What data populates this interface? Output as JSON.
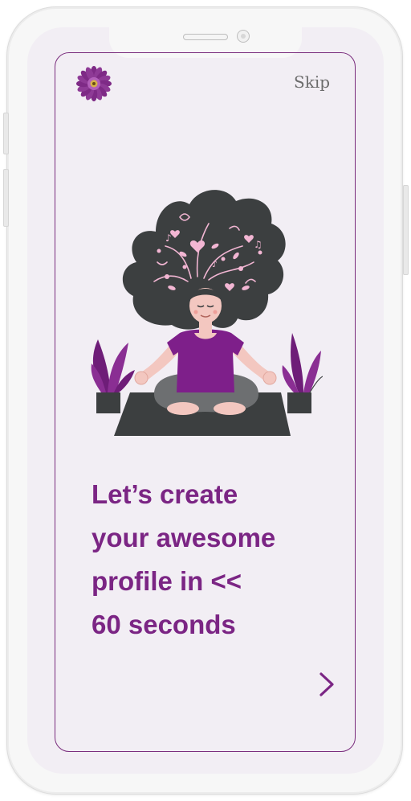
{
  "header": {
    "skip_label": "Skip"
  },
  "icons": {
    "logo": "purple-flower-icon",
    "next": "chevron-right-icon"
  },
  "hero": {
    "illustration": "meditating-woman-illustration"
  },
  "main": {
    "headline_lines": [
      "Let’s create",
      "your awesome",
      "profile in <<",
      "60 seconds"
    ]
  },
  "colors": {
    "accent": "#7b2584",
    "frame": "#7a2d7d",
    "screen_bg": "#f2eef4",
    "hair": "#3c3f40",
    "doodle": "#f2b6d3"
  }
}
